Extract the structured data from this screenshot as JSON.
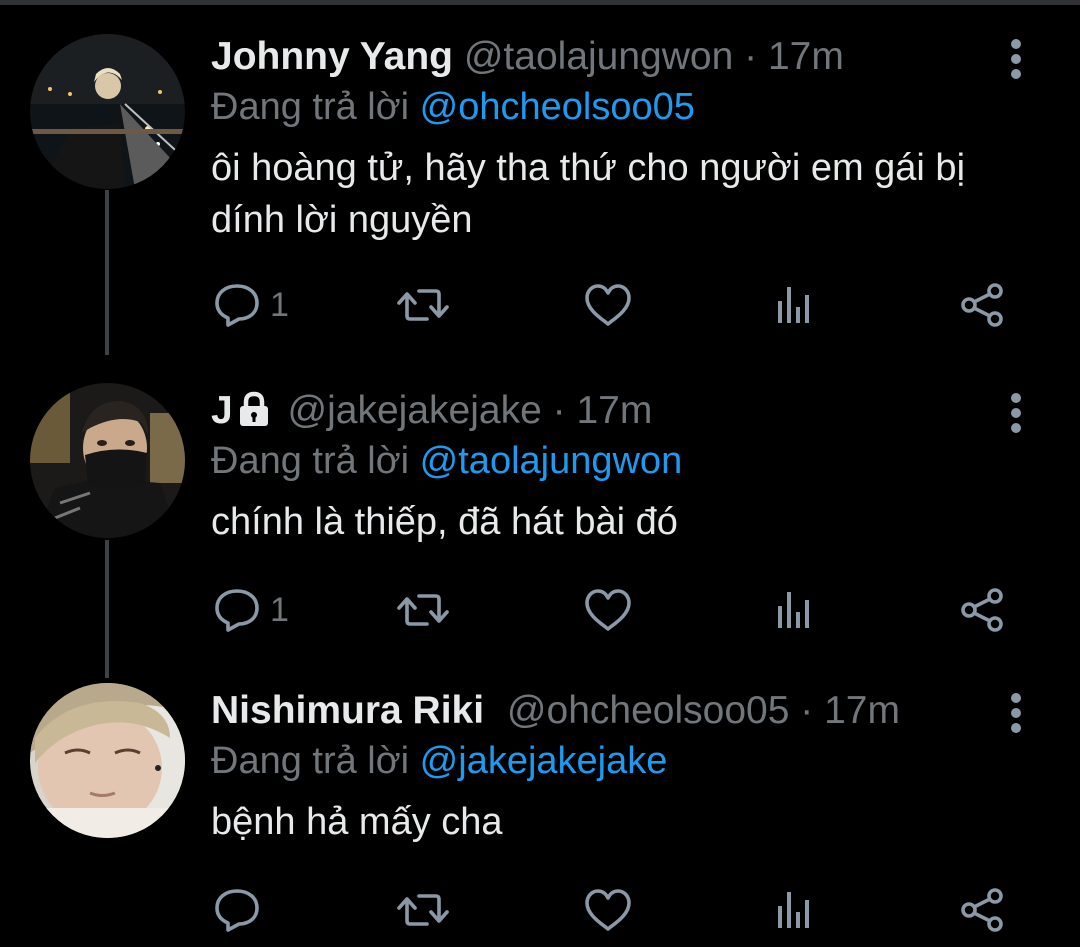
{
  "tweets": [
    {
      "name": "Johnny Yang",
      "handle": "@taolajungwon",
      "separator": "·",
      "time": "17m",
      "locked": false,
      "reply_prefix": "Đang trả lời",
      "reply_to": "@ohcheolsoo05",
      "text": "ôi hoàng tử, hãy tha thứ cho người em gái bị dính lời nguyền",
      "reply_count": "1",
      "avatar_icon": "night-bridge-photo"
    },
    {
      "name": "J",
      "handle": "@jakejakejake",
      "separator": "·",
      "time": "17m",
      "locked": true,
      "reply_prefix": "Đang trả lời",
      "reply_to": "@taolajungwon",
      "text": "chính là thiếp, đã hát bài đó",
      "reply_count": "1",
      "avatar_icon": "masked-person-photo"
    },
    {
      "name": "Nishimura Riki",
      "handle": "@ohcheolsoo05",
      "separator": "·",
      "time": "17m",
      "locked": false,
      "reply_prefix": "Đang trả lời",
      "reply_to": "@jakejakejake",
      "text": "bệnh hả mấy cha",
      "reply_count": "",
      "avatar_icon": "face-closeup-photo"
    }
  ],
  "icons": {
    "reply": "reply-icon",
    "retweet": "retweet-icon",
    "like": "like-icon",
    "analytics": "analytics-icon",
    "share": "share-icon",
    "more": "more-vertical-icon",
    "lock": "lock-icon"
  },
  "colors": {
    "background": "#000000",
    "text": "#e7e9ea",
    "muted": "#71767b",
    "mention": "#1d9bf0",
    "icon": "#8b98a5",
    "thread_line": "#3d4248"
  }
}
